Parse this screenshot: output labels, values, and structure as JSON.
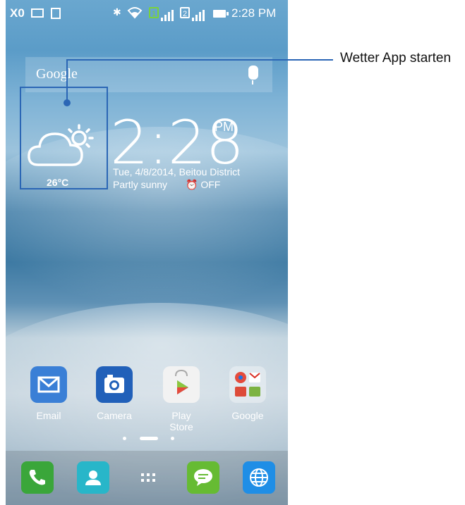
{
  "status_bar": {
    "left_icons": [
      "mute-icon",
      "image-icon",
      "battery-saver-icon"
    ],
    "mute_text": "X0",
    "right_icons": [
      "bluetooth-icon",
      "wifi-icon",
      "sim1-icon",
      "signal-icon",
      "sim2-icon",
      "signal-icon",
      "battery-icon"
    ],
    "sim1": "1",
    "sim2": "2",
    "time": "2:28 PM"
  },
  "search": {
    "logo": "Google",
    "mic_icon": "microphone-icon"
  },
  "weather": {
    "icon": "partly-sunny-icon",
    "temperature": "26°C"
  },
  "clock": {
    "time": "2:28",
    "ampm": "PM",
    "date_location": "Tue, 4/8/2014, Beitou District",
    "condition": "Partly sunny",
    "alarm": "OFF"
  },
  "callout": {
    "label": "Wetter App starten"
  },
  "apps": [
    {
      "label": "Email",
      "icon": "email-icon"
    },
    {
      "label": "Camera",
      "icon": "camera-icon"
    },
    {
      "label": "Play Store",
      "icon": "play-store-icon"
    },
    {
      "label": "Google",
      "icon": "google-folder-icon"
    }
  ],
  "dock": [
    {
      "icon": "phone-icon"
    },
    {
      "icon": "contacts-icon"
    },
    {
      "icon": "app-drawer-icon"
    },
    {
      "icon": "messaging-icon"
    },
    {
      "icon": "browser-icon"
    }
  ],
  "colors": {
    "accent": "#2b66b5",
    "phone_green": "#3aa63a",
    "contacts_teal": "#28b6c9",
    "messaging_green": "#66bb33",
    "browser_blue": "#1f8ee6",
    "email_blue": "#3a7fd6",
    "camera_blue": "#2160b9"
  }
}
